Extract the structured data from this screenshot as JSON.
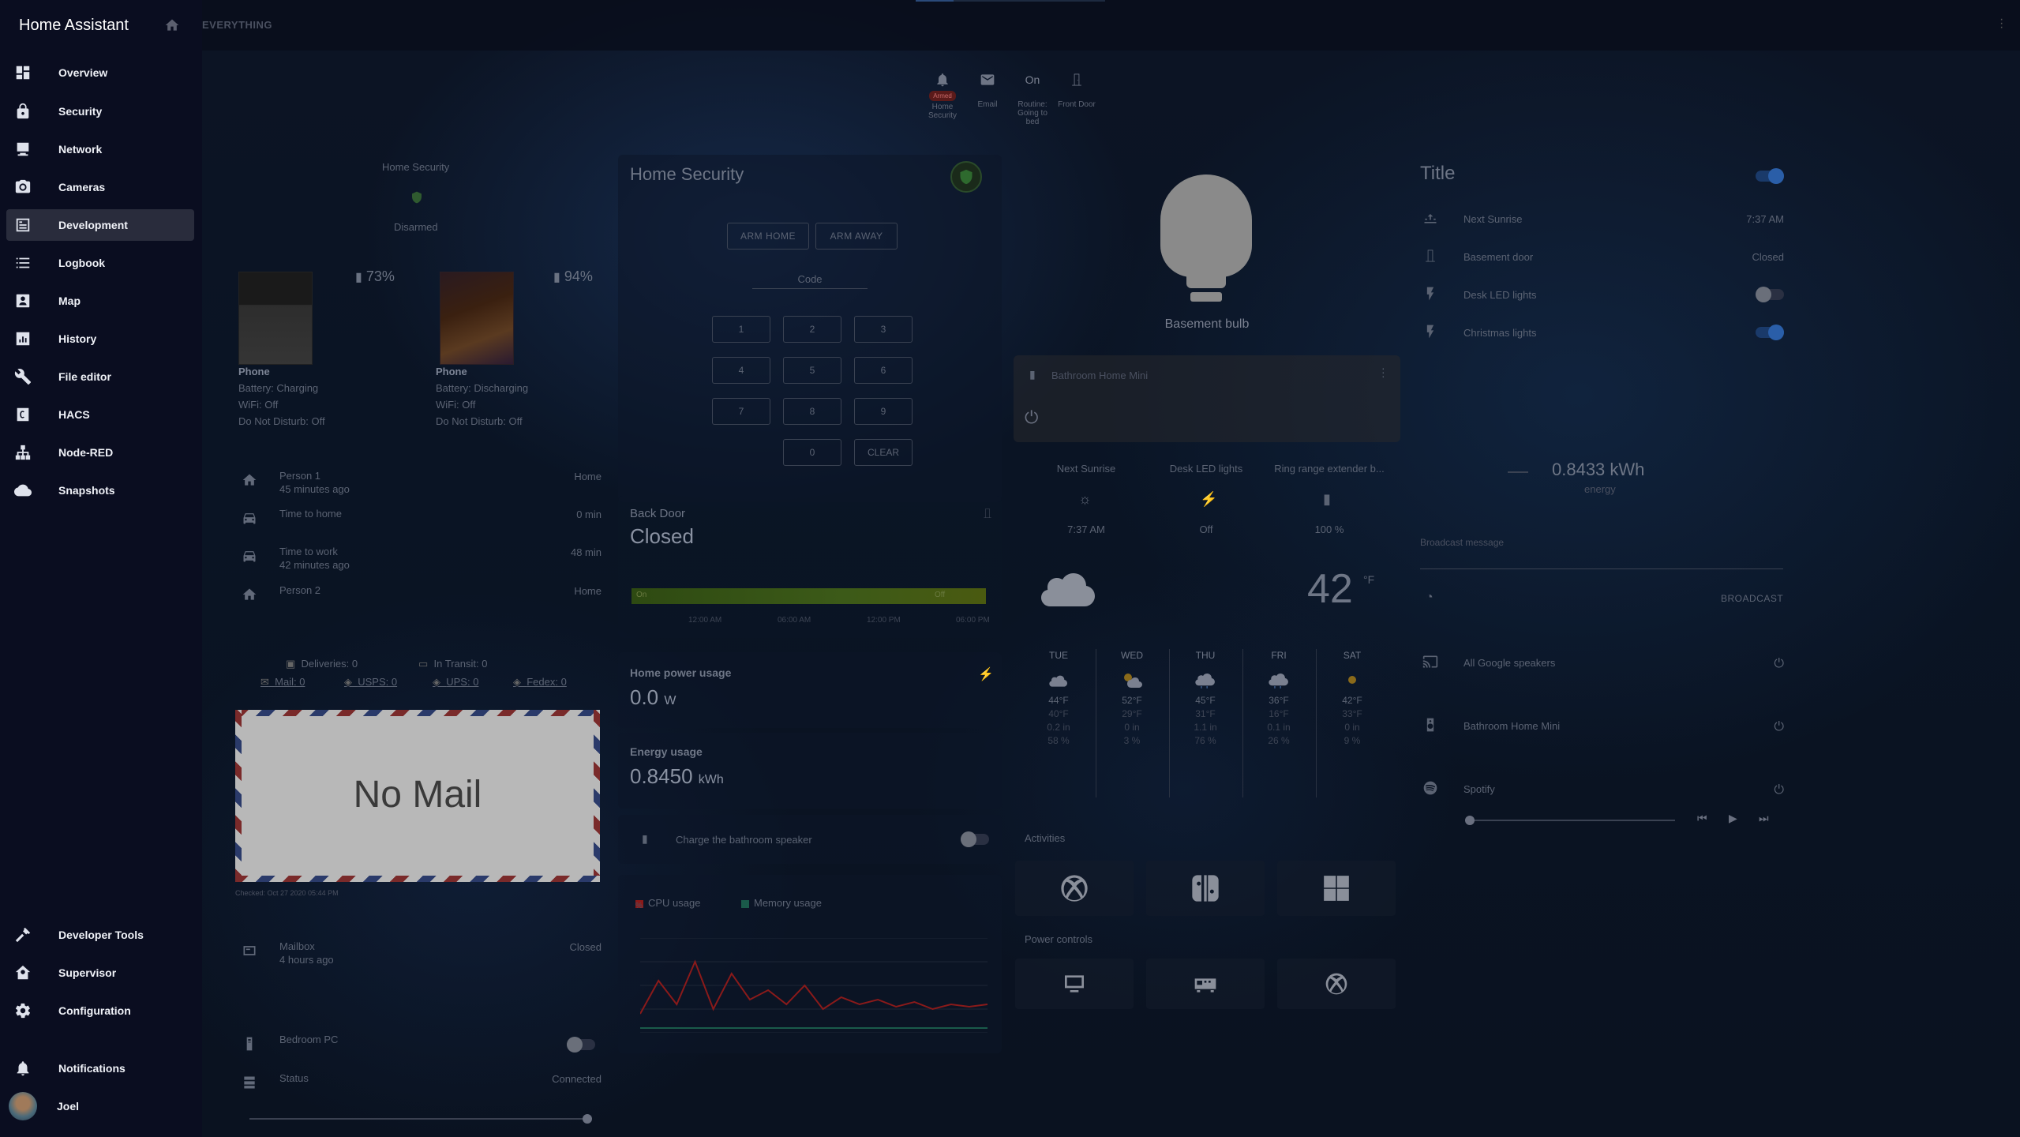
{
  "app": {
    "title": "Home Assistant"
  },
  "topbar": {
    "view_title": "EVERYTHING"
  },
  "sidebar": {
    "items": [
      {
        "label": "Overview",
        "icon": "dashboard-icon"
      },
      {
        "label": "Security",
        "icon": "lock-icon"
      },
      {
        "label": "Network",
        "icon": "monitor-icon"
      },
      {
        "label": "Cameras",
        "icon": "camera-icon"
      },
      {
        "label": "Development",
        "icon": "development-icon",
        "active": true
      },
      {
        "label": "Logbook",
        "icon": "list-icon"
      },
      {
        "label": "Map",
        "icon": "map-icon"
      },
      {
        "label": "History",
        "icon": "chart-icon"
      },
      {
        "label": "File editor",
        "icon": "wrench-icon"
      },
      {
        "label": "HACS",
        "icon": "hacs-icon"
      },
      {
        "label": "Node-RED",
        "icon": "sitemap-icon"
      },
      {
        "label": "Snapshots",
        "icon": "cloud-icon"
      }
    ],
    "bottom": [
      {
        "label": "Developer Tools",
        "icon": "hammer-icon"
      },
      {
        "label": "Supervisor",
        "icon": "supervisor-icon"
      },
      {
        "label": "Configuration",
        "icon": "gear-icon"
      },
      {
        "label": "Notifications",
        "icon": "bell-icon"
      },
      {
        "label": "Joel",
        "icon": "avatar"
      }
    ]
  },
  "shortcuts": [
    {
      "label": "Home Security",
      "badge": "Armed"
    },
    {
      "label": "Email"
    },
    {
      "label": "Routine: Going to bed",
      "state": "On"
    },
    {
      "label": "Front Door"
    }
  ],
  "col1": {
    "alarm_label": "Home Security",
    "alarm_state": "Disarmed",
    "phones": [
      {
        "name": "Phone",
        "battery": "73%",
        "battery_state": "Battery: Charging",
        "wifi": "WiFi: Off",
        "dnd": "Do Not Disturb: Off"
      },
      {
        "name": "Phone",
        "battery": "94%",
        "battery_state": "Battery: Discharging",
        "wifi": "WiFi: Off",
        "dnd": "Do Not Disturb: Off"
      }
    ],
    "people": [
      {
        "name": "Person 1",
        "sub": "45 minutes ago",
        "value": "Home"
      },
      {
        "name": "Time to home",
        "sub": "",
        "value": "0 min"
      },
      {
        "name": "Time to work",
        "sub": "42 minutes ago",
        "value": "48 min"
      },
      {
        "name": "Person 2",
        "sub": "",
        "value": "Home"
      }
    ],
    "packages": {
      "deliveries": "Deliveries: 0",
      "in_transit": "In Transit: 0",
      "mail": "Mail: 0",
      "usps": "USPS: 0",
      "ups": "UPS: 0",
      "fedex": "Fedex: 0"
    },
    "mail_text": "No Mail",
    "checked": "Checked: Oct 27 2020 05:44 PM",
    "mailbox": {
      "name": "Mailbox",
      "sub": "4 hours ago",
      "value": "Closed"
    },
    "bedroom_pc": {
      "name": "Bedroom PC"
    },
    "status": {
      "name": "Status",
      "value": "Connected"
    }
  },
  "col2": {
    "alarm_title": "Home Security",
    "arm_home": "ARM HOME",
    "arm_away": "ARM AWAY",
    "code_label": "Code",
    "keys": [
      "1",
      "2",
      "3",
      "4",
      "5",
      "6",
      "7",
      "8",
      "9",
      "0",
      "CLEAR"
    ],
    "back_door_label": "Back Door",
    "back_door_state": "Closed",
    "bar_left": "On",
    "bar_right": "Off",
    "bar_times": [
      "12:00 AM",
      "06:00 AM",
      "12:00 PM",
      "06:00 PM"
    ],
    "power_label": "Home power usage",
    "power_value": "0.0",
    "power_unit": "W",
    "energy_label": "Energy usage",
    "energy_value": "0.8450",
    "energy_unit": "kWh",
    "charge_label": "Charge the bathroom speaker",
    "legend_cpu": "CPU usage",
    "legend_mem": "Memory usage",
    "y_unit": "%"
  },
  "col3": {
    "bulb_label": "Basement bulb",
    "media_label": "Bathroom Home Mini",
    "glance": [
      {
        "label": "Next Sunrise",
        "value": "7:37 AM"
      },
      {
        "label": "Desk LED lights",
        "value": "Off"
      },
      {
        "label": "Ring range extender b...",
        "value": "100 %"
      }
    ],
    "temp": "42",
    "temp_unit": "°F",
    "forecast": [
      {
        "day": "TUE",
        "hi": "44°F",
        "lo": "40°F",
        "precip": "0.2 in",
        "pct": "58 %"
      },
      {
        "day": "WED",
        "hi": "52°F",
        "lo": "29°F",
        "precip": "0 in",
        "pct": "3 %"
      },
      {
        "day": "THU",
        "hi": "45°F",
        "lo": "31°F",
        "precip": "1.1 in",
        "pct": "76 %"
      },
      {
        "day": "FRI",
        "hi": "36°F",
        "lo": "16°F",
        "precip": "0.1 in",
        "pct": "26 %"
      },
      {
        "day": "SAT",
        "hi": "42°F",
        "lo": "33°F",
        "precip": "0 in",
        "pct": "9 %"
      }
    ],
    "activities_label": "Activities",
    "power_controls_label": "Power controls"
  },
  "col4": {
    "title": "Title",
    "rows": [
      {
        "name": "Next Sunrise",
        "value": "7:37 AM"
      },
      {
        "name": "Basement door",
        "value": "Closed"
      },
      {
        "name": "Desk LED lights",
        "value": ""
      },
      {
        "name": "Christmas lights",
        "value": ""
      }
    ],
    "energy_value": "0.8433 kWh",
    "energy_label": "energy",
    "broadcast_label": "Broadcast message",
    "broadcast_btn": "BROADCAST",
    "speakers": [
      {
        "name": "All Google speakers"
      },
      {
        "name": "Bathroom Home Mini"
      },
      {
        "name": "Spotify"
      }
    ]
  },
  "chart_data": {
    "type": "line",
    "series": [
      {
        "name": "CPU usage",
        "values": [
          8,
          22,
          12,
          30,
          10,
          25,
          14,
          18,
          12,
          20,
          10,
          15,
          12,
          14,
          11,
          13,
          10,
          12,
          11,
          12
        ]
      },
      {
        "name": "Memory usage",
        "values": [
          2,
          2,
          2,
          2,
          2,
          2,
          2,
          2,
          2,
          2,
          2,
          2,
          2,
          2,
          2,
          2,
          2,
          2,
          2,
          2
        ]
      }
    ],
    "ylabel": "%"
  }
}
